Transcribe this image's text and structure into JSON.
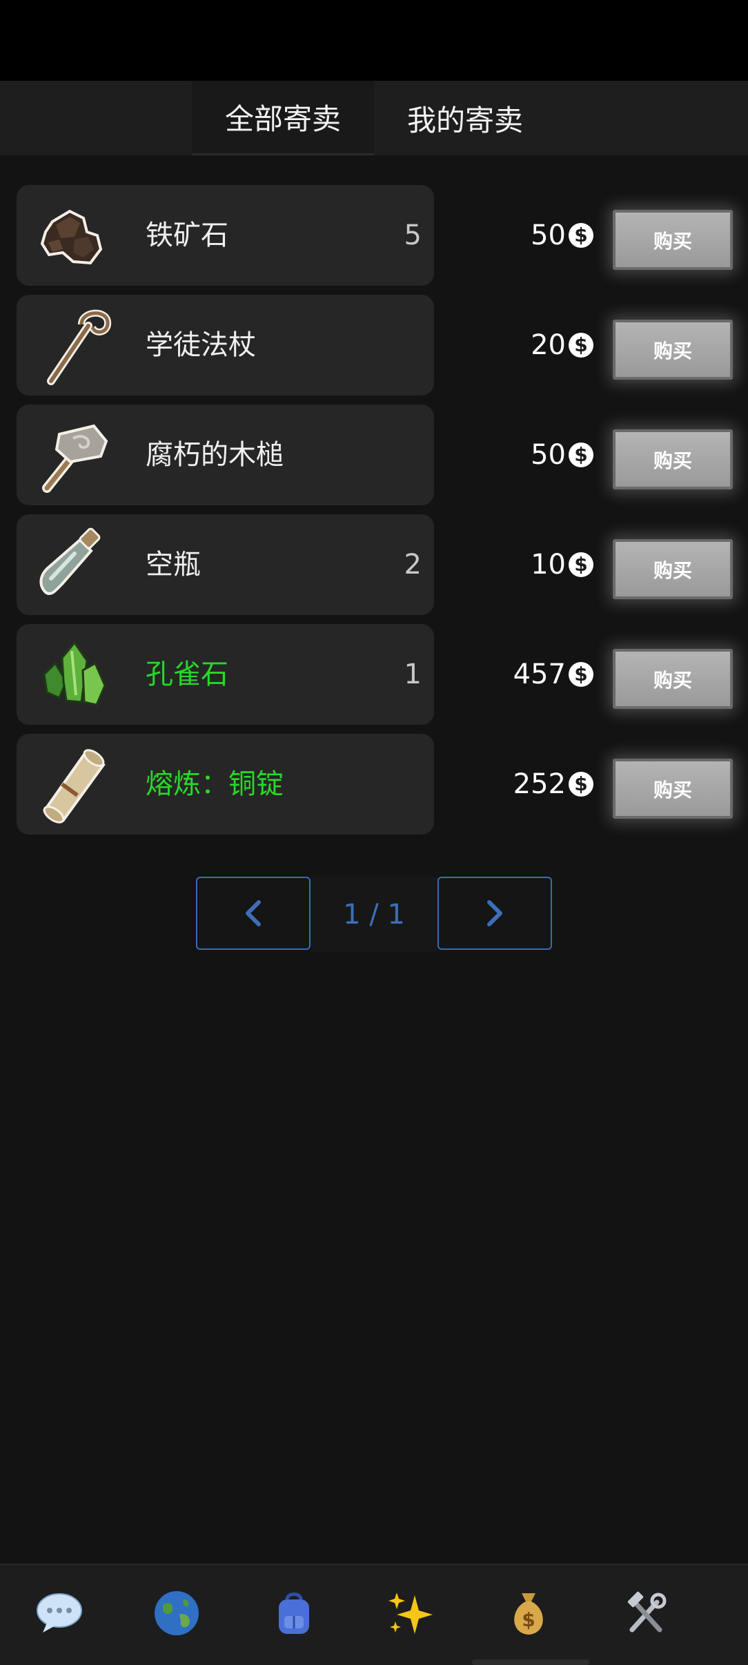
{
  "tabs": {
    "all": "全部寄卖",
    "mine": "我的寄卖"
  },
  "buy_label": "购买",
  "coin_symbol": "$",
  "items": [
    {
      "name": "铁矿石",
      "qty": "5",
      "price": "50",
      "color": "#f0f0f0",
      "icon": "iron-ore-icon"
    },
    {
      "name": "学徒法杖",
      "qty": "",
      "price": "20",
      "color": "#f0f0f0",
      "icon": "apprentice-staff-icon"
    },
    {
      "name": "腐朽的木槌",
      "qty": "",
      "price": "50",
      "color": "#f0f0f0",
      "icon": "rotten-mallet-icon"
    },
    {
      "name": "空瓶",
      "qty": "2",
      "price": "10",
      "color": "#f0f0f0",
      "icon": "empty-bottle-icon"
    },
    {
      "name": "孔雀石",
      "qty": "1",
      "price": "457",
      "color": "#29d829",
      "icon": "malachite-icon"
    },
    {
      "name": "熔炼：铜锭",
      "qty": "",
      "price": "252",
      "color": "#29d829",
      "icon": "scroll-icon"
    }
  ],
  "pagination": {
    "current": "1 / 1"
  },
  "colors": {
    "accent": "#3d6fb8",
    "rare": "#29d829",
    "background": "#131313"
  },
  "bottom_nav": [
    {
      "icon": "chat-icon"
    },
    {
      "icon": "globe-icon"
    },
    {
      "icon": "backpack-icon"
    },
    {
      "icon": "sparkles-icon"
    },
    {
      "icon": "money-bag-icon"
    },
    {
      "icon": "tools-icon"
    }
  ]
}
